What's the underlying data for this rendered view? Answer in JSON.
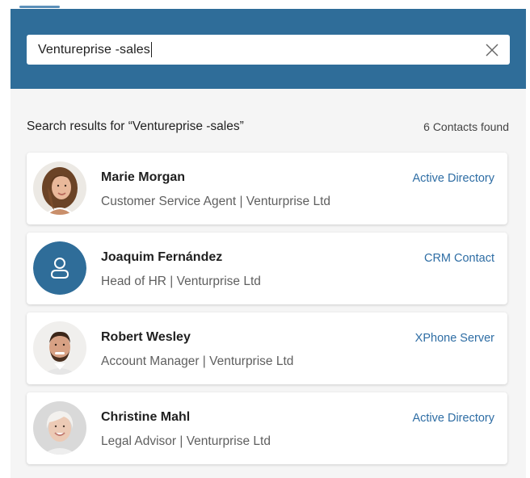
{
  "search": {
    "value": "Ventureprise -sales"
  },
  "results": {
    "title": "Search results for “Ventureprise -sales”",
    "count_label": "6 Contacts found"
  },
  "contacts": [
    {
      "name": "Marie Morgan",
      "subtitle": "Customer Service Agent | Venturprise Ltd",
      "source": "Active Directory",
      "avatar": "photo-woman-brown-hair"
    },
    {
      "name": "Joaquim Fernández",
      "subtitle": "Head of HR | Venturprise Ltd",
      "source": "CRM Contact",
      "avatar": "person-placeholder-icon"
    },
    {
      "name": "Robert Wesley",
      "subtitle": "Account Manager | Venturprise Ltd",
      "source": "XPhone Server",
      "avatar": "photo-man-beard"
    },
    {
      "name": "Christine Mahl",
      "subtitle": "Legal Advisor | Venturprise Ltd",
      "source": "Active Directory",
      "avatar": "photo-woman-gray-hair"
    }
  ],
  "colors": {
    "header": "#2f6d99",
    "accent_link": "#2e6da4",
    "panel_bg": "#f5f5f5",
    "placeholder_avatar": "#2f6d99"
  }
}
